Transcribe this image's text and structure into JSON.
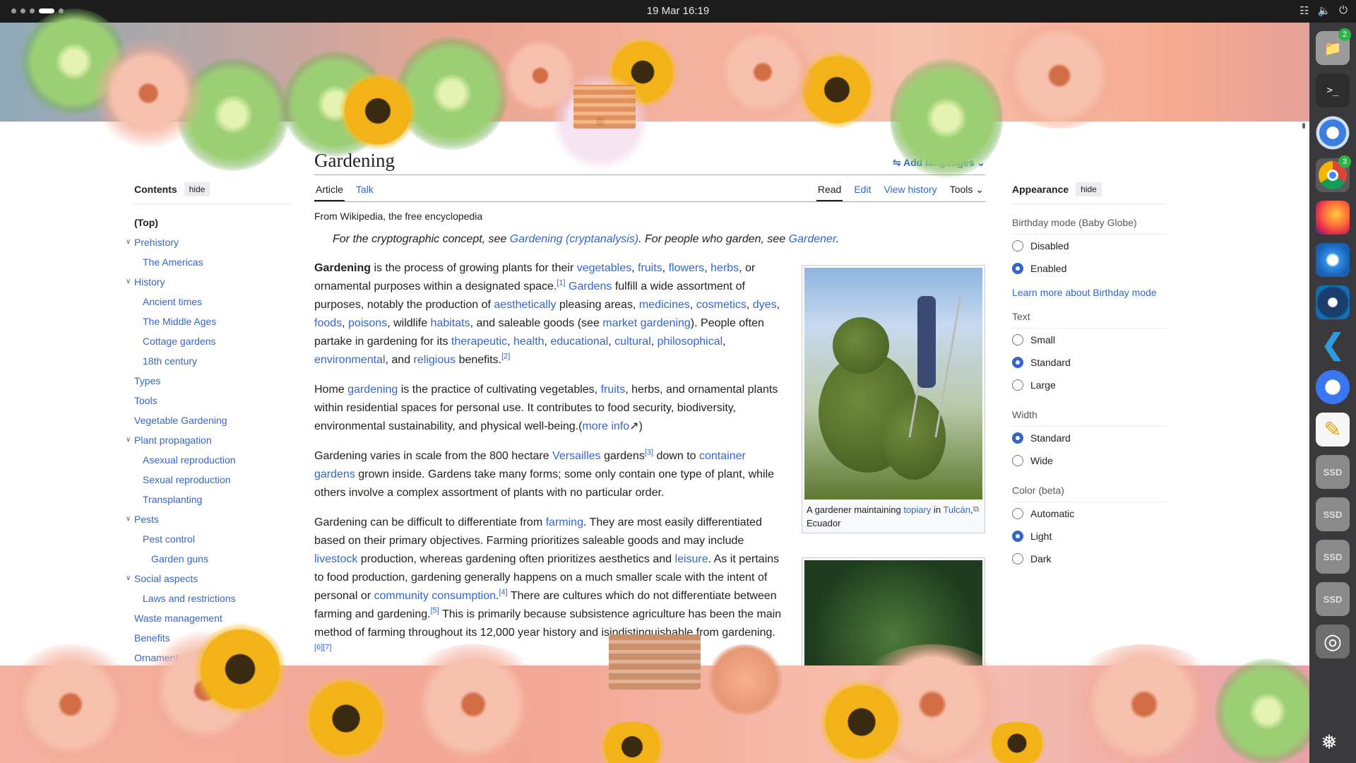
{
  "topbar": {
    "clock": "19 Mar  16:19"
  },
  "dock": {
    "badges": {
      "files": "2",
      "chrome": "3"
    },
    "ssd_label": "SSD"
  },
  "toc": {
    "title": "Contents",
    "hide": "hide",
    "items": [
      {
        "label": "(Top)",
        "level": 0,
        "top": true
      },
      {
        "label": "Prehistory",
        "level": 0,
        "chev": true
      },
      {
        "label": "The Americas",
        "level": 1
      },
      {
        "label": "History",
        "level": 0,
        "chev": true
      },
      {
        "label": "Ancient times",
        "level": 1
      },
      {
        "label": "The Middle Ages",
        "level": 1
      },
      {
        "label": "Cottage gardens",
        "level": 1
      },
      {
        "label": "18th century",
        "level": 1
      },
      {
        "label": "Types",
        "level": 0
      },
      {
        "label": "Tools",
        "level": 0
      },
      {
        "label": "Vegetable Gardening",
        "level": 0
      },
      {
        "label": "Plant propagation",
        "level": 0,
        "chev": true
      },
      {
        "label": "Asexual reproduction",
        "level": 1
      },
      {
        "label": "Sexual reproduction",
        "level": 1
      },
      {
        "label": "Transplanting",
        "level": 1
      },
      {
        "label": "Pests",
        "level": 0,
        "chev": true
      },
      {
        "label": "Pest control",
        "level": 1
      },
      {
        "label": "Garden guns",
        "level": 2
      },
      {
        "label": "Social aspects",
        "level": 0,
        "chev": true
      },
      {
        "label": "Laws and restrictions",
        "level": 1
      },
      {
        "label": "Waste management",
        "level": 0
      },
      {
        "label": "Benefits",
        "level": 0
      },
      {
        "label": "Ornaments and a",
        "level": 0
      }
    ]
  },
  "article": {
    "title": "Gardening",
    "languages": "Add languages",
    "tabs_left": [
      "Article",
      "Talk"
    ],
    "tabs_right": [
      "Read",
      "Edit",
      "View history",
      "Tools"
    ],
    "from": "From Wikipedia, the free encyclopedia",
    "hatnote": {
      "a": "For the cryptographic concept, see ",
      "l1": "Gardening (cryptanalysis)",
      "b": ". For people who garden, see ",
      "l2": "Gardener",
      "c": "."
    },
    "p1": [
      "Gardening",
      " is the process of growing plants for their ",
      "vegetables",
      ", ",
      "fruits",
      ", ",
      "flowers",
      ", ",
      "herbs",
      ", or ornamental purposes within a designated space.",
      "[1]",
      " ",
      "Gardens",
      " fulfill a wide assortment of purposes, notably the production of ",
      "aesthetically",
      " pleasing areas, ",
      "medicines",
      ", ",
      "cosmetics",
      ", ",
      "dyes",
      ", ",
      "foods",
      ", ",
      "poisons",
      ", wildlife ",
      "habitats",
      ", and saleable goods (see ",
      "market gardening",
      "). People often partake in gardening for its ",
      "therapeutic",
      ", ",
      "health",
      ", ",
      "educational",
      ", ",
      "cultural",
      ", ",
      "philosophical",
      ", ",
      "environmental",
      ", and ",
      "religious",
      " benefits.",
      "[2]"
    ],
    "p2": [
      "Home ",
      "gardening",
      " is the practice of cultivating vegetables, ",
      "fruits",
      ", herbs, and ornamental plants within residential spaces for personal use. It contributes to food security, biodiversity, environmental sustainability, and physical well-being.(",
      "more info",
      "↗",
      ")"
    ],
    "p3": [
      "Gardening varies in scale from the 800 hectare ",
      "Versailles",
      " gardens",
      "[3]",
      " down to ",
      "container gardens",
      " grown inside. Gardens take many forms; some only contain one type of plant, while others involve a complex assortment of plants with no particular order."
    ],
    "p4": [
      "Gardening can be difficult to differentiate from ",
      "farming",
      ". They are most easily differentiated based on their primary objectives. Farming prioritizes saleable goods and may include ",
      "livestock",
      " production, whereas gardening often prioritizes aesthetics and ",
      "leisure",
      ". As it pertains to food production, gardening generally happens on a much smaller scale with the intent of personal or ",
      "community consumption",
      ".",
      "[4]",
      " There are cultures which do not differentiate between farming and gardening.",
      "[5]",
      " This is primarily because ",
      "subsistence agriculture",
      " has been the main method of farming throughout its 12,000 year history and is",
      "indistinguishable from gardening.",
      "[6][7]"
    ],
    "fig1_caption": {
      "a": "A gardener maintaining ",
      "l1": "topiary",
      " b": " in ",
      "l2": "Tulcán",
      "c": ", Ecuador"
    }
  },
  "appearance": {
    "title": "Appearance",
    "hide": "hide",
    "groups": [
      {
        "label": "Birthday mode (Baby Globe)",
        "options": [
          "Disabled",
          "Enabled"
        ],
        "selected": 1
      },
      {
        "label": "Text",
        "options": [
          "Small",
          "Standard",
          "Large"
        ],
        "selected": 1
      },
      {
        "label": "Width",
        "options": [
          "Standard",
          "Wide"
        ],
        "selected": 0
      },
      {
        "label": "Color (beta)",
        "options": [
          "Automatic",
          "Light",
          "Dark"
        ],
        "selected": 1
      }
    ],
    "learn": "Learn more about Birthday mode"
  }
}
